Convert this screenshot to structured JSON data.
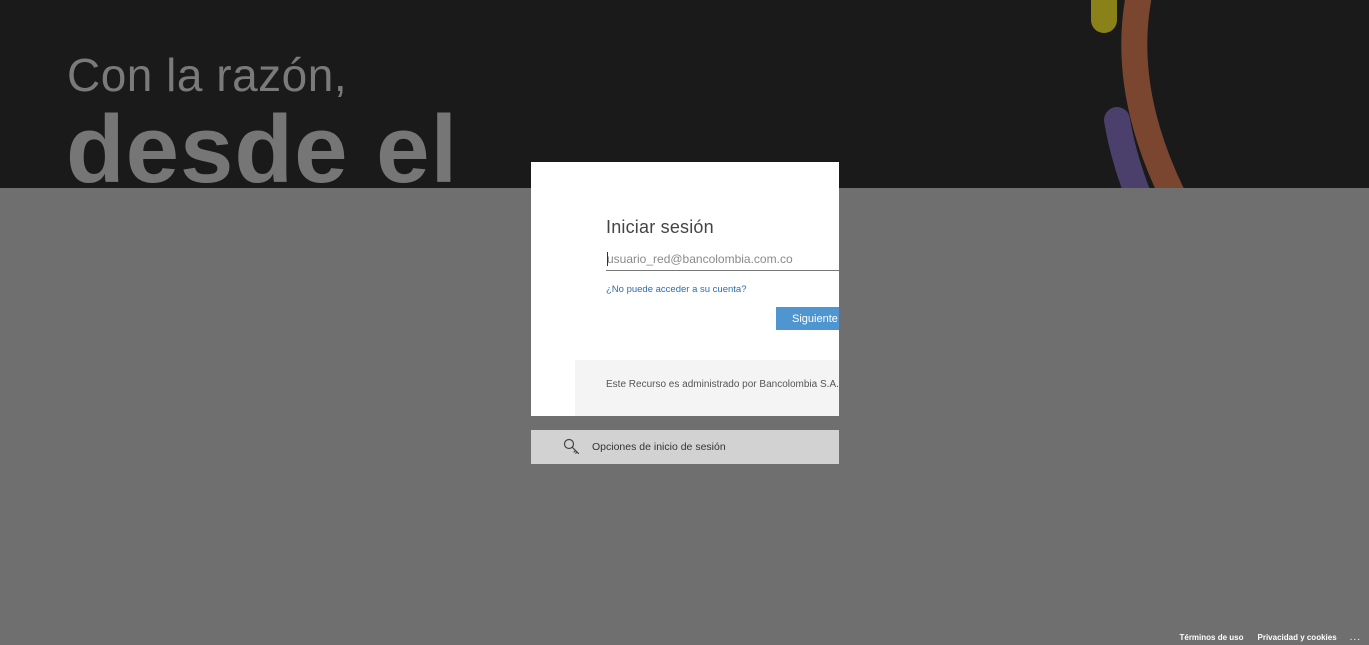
{
  "hero": {
    "line1": "Con la razón,",
    "line2": "desde el"
  },
  "login": {
    "title": "Iniciar sesión",
    "email_placeholder": "usuario_red@bancolombia.com.co",
    "cant_access_link": "¿No puede acceder a su cuenta?",
    "next_button": "Siguiente",
    "admin_notice": "Este Recurso es administrado por Bancolombia S.A."
  },
  "signin_options": {
    "label": "Opciones de inicio de sesión",
    "icon": "key-icon"
  },
  "footer": {
    "terms": "Términos de uso",
    "privacy": "Privacidad y cookies",
    "more": "..."
  },
  "colors": {
    "hero_bg": "#1a1a1a",
    "overlay": "#6f6f6f",
    "accent": "#4f95d0",
    "decor_yellow": "#8a8219",
    "decor_brown": "#7a4630",
    "decor_purple": "#4b3f6b"
  }
}
